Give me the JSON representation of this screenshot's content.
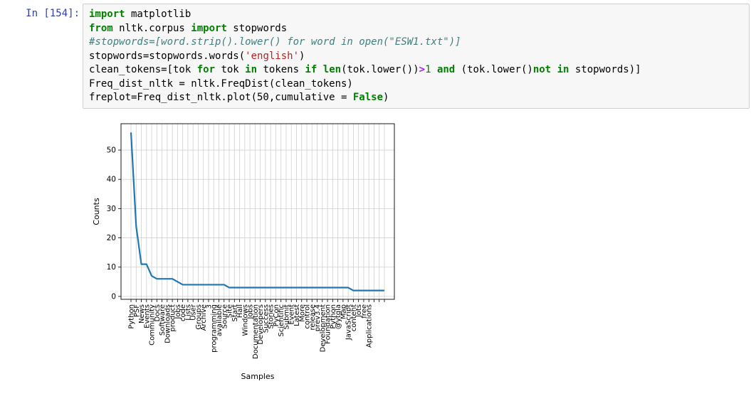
{
  "cell": {
    "prompt": "In [154]:",
    "code": [
      [
        [
          "kw",
          "import"
        ],
        [
          "t",
          " matplotlib"
        ]
      ],
      [
        [
          "kw",
          "from"
        ],
        [
          "t",
          " nltk.corpus "
        ],
        [
          "kw",
          "import"
        ],
        [
          "t",
          " stopwords"
        ]
      ],
      [
        [
          "cm",
          "#stopwords=[word.strip().lower() for word in open(\"ESW1.txt\")]"
        ]
      ],
      [
        [
          "t",
          "stopwords=stopwords.words("
        ],
        [
          "st",
          "'english'"
        ],
        [
          "t",
          ")"
        ]
      ],
      [
        [
          "t",
          "clean_tokens=[tok "
        ],
        [
          "kw",
          "for"
        ],
        [
          "t",
          " tok "
        ],
        [
          "kw",
          "in"
        ],
        [
          "t",
          " tokens "
        ],
        [
          "kw",
          "if"
        ],
        [
          "t",
          " "
        ],
        [
          "kw",
          "len"
        ],
        [
          "t",
          "(tok.lower())"
        ],
        [
          "op",
          ">"
        ],
        [
          "nu",
          "1"
        ],
        [
          "t",
          " "
        ],
        [
          "kw",
          "and"
        ],
        [
          "t",
          " (tok.lower()"
        ],
        [
          "kw",
          "not"
        ],
        [
          "t",
          " "
        ],
        [
          "kw",
          "in"
        ],
        [
          "t",
          " stopwords)]"
        ]
      ],
      [
        [
          "t",
          "Freq_dist_nltk = nltk.FreqDist(clean_tokens)"
        ]
      ],
      [
        [
          "t",
          "freplot=Freq_dist_nltk.plot(50,cumulative = "
        ],
        [
          "kw",
          "False"
        ],
        [
          "t",
          ")"
        ]
      ]
    ]
  },
  "chart_data": {
    "type": "line",
    "xlabel": "Samples",
    "ylabel": "Counts",
    "ylim": [
      -1,
      59
    ],
    "yticks": [
      0,
      10,
      20,
      30,
      40,
      50
    ],
    "grid": true,
    "line_color": "#1f77b4",
    "categories": [
      "Python",
      "PSF",
      "News",
      "Events",
      "Community",
      "Docs",
      "Software",
      "Downloads",
      "product",
      "Jobs",
      "code",
      "Lists",
      "User",
      "Groups",
      "Archive",
      "3",
      "programming",
      "available",
      "Source",
      "Site",
      "Start",
      "Hall",
      "Windows",
      "Jobs",
      "Documentation",
      "Developers",
      "Success",
      "Stories",
      "PyCon",
      "Scientific",
      "Submit",
      "Event",
      "Latest",
      "More",
      "control",
      "release",
      "prev3.4",
      "Development",
      "Foundation",
      "Python",
      "@ytgla",
      "Map",
      "JavaScript",
      "content",
      "lots",
      "free",
      "Applications"
    ],
    "values": [
      56,
      24,
      11,
      11,
      7,
      6,
      6,
      6,
      6,
      5,
      4,
      4,
      4,
      4,
      4,
      4,
      4,
      4,
      4,
      3,
      3,
      3,
      3,
      3,
      3,
      3,
      3,
      3,
      3,
      3,
      3,
      3,
      3,
      3,
      3,
      3,
      3,
      3,
      3,
      3,
      3,
      3,
      3,
      2,
      2,
      2,
      2,
      2,
      2,
      2
    ]
  }
}
